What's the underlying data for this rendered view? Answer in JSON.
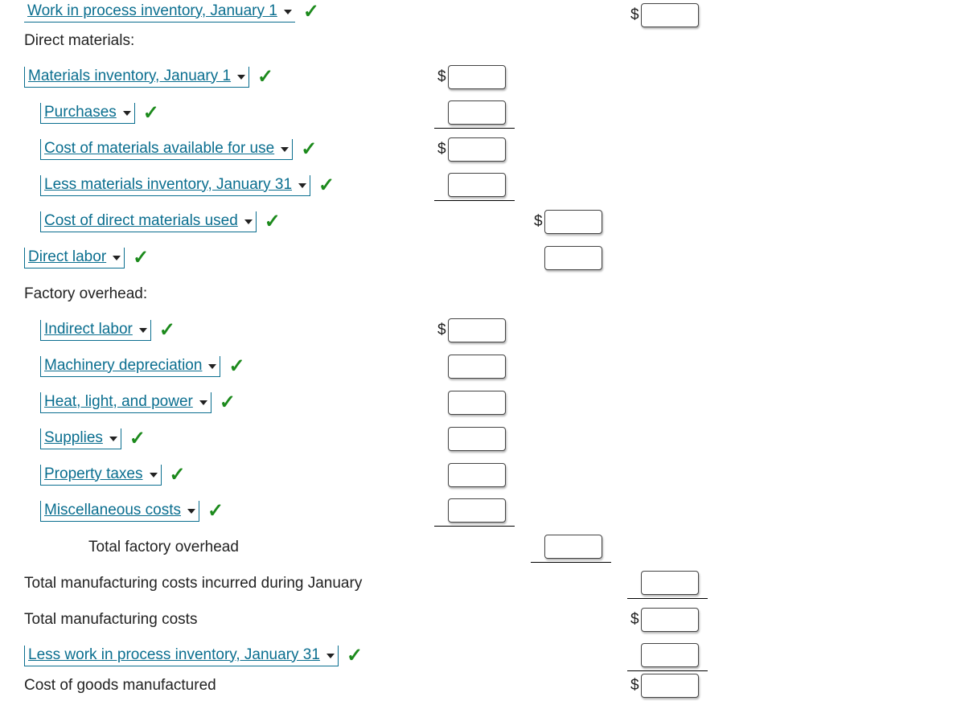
{
  "rows": {
    "wip_jan1": "Work in process inventory, January 1",
    "direct_materials_header": "Direct materials:",
    "mat_inv_jan1": "Materials inventory, January 1",
    "purchases": "Purchases",
    "cost_mat_avail": "Cost of materials available for use",
    "less_mat_jan31": "Less materials inventory, January 31",
    "cost_direct_mat_used": "Cost of direct materials used",
    "direct_labor": "Direct labor",
    "factory_overhead_header": "Factory overhead:",
    "indirect_labor": "Indirect labor",
    "machinery_dep": "Machinery depreciation",
    "heat_light_power": "Heat, light, and power",
    "supplies": "Supplies",
    "property_taxes": "Property taxes",
    "misc_costs": "Miscellaneous costs",
    "total_factory_overhead": "Total factory overhead",
    "total_mfg_costs_incurred": "Total manufacturing costs incurred during January",
    "total_mfg_costs": "Total manufacturing costs",
    "less_wip_jan31": "Less work in process inventory, January 31",
    "cogs_manufactured": "Cost of goods manufactured"
  },
  "currency": "$"
}
